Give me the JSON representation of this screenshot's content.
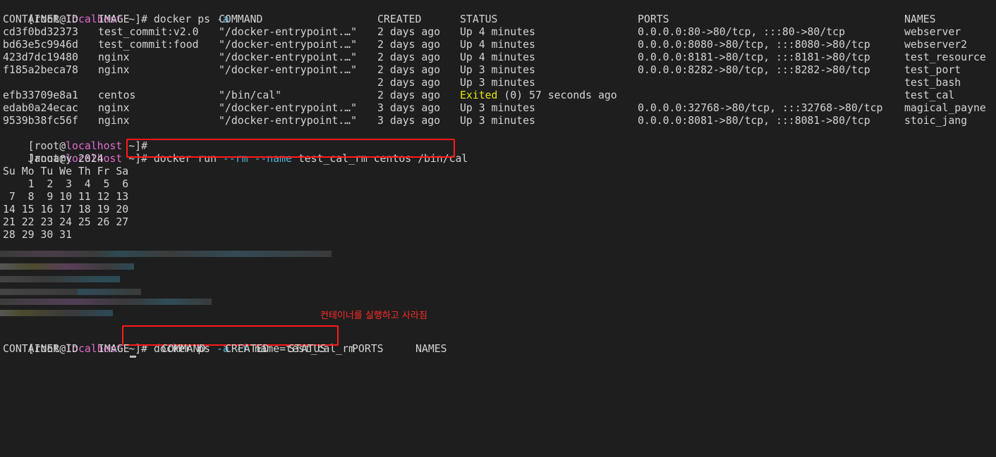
{
  "prompt": {
    "user": "root",
    "host": "localhost",
    "path": "~",
    "open": "[",
    "at": "@",
    "close_symbol": "]# "
  },
  "cmd1": {
    "text": "docker ps ",
    "flag": "-a"
  },
  "ps_table": {
    "headers": [
      "CONTAINER ID",
      "IMAGE",
      "COMMAND",
      "CREATED",
      "STATUS",
      "PORTS",
      "NAMES"
    ],
    "rows": [
      [
        "cd3f0bd32373",
        "test_commit:v2.0",
        "\"/docker-entrypoint.…\"",
        "2 days ago",
        "Up 4 minutes",
        "0.0.0.0:80->80/tcp, :::80->80/tcp",
        "webserver"
      ],
      [
        "bd63e5c9946d",
        "test_commit:food",
        "\"/docker-entrypoint.…\"",
        "2 days ago",
        "Up 4 minutes",
        "0.0.0.0:8080->80/tcp, :::8080->80/tcp",
        "webserver2"
      ],
      [
        "423d7dc19480",
        "nginx",
        "\"/docker-entrypoint.…\"",
        "2 days ago",
        "Up 4 minutes",
        "0.0.0.0:8181->80/tcp, :::8181->80/tcp",
        "test_resource"
      ],
      [
        "f185a2beca78",
        "nginx",
        "\"/docker-entrypoint.…\"",
        "2 days ago",
        "Up 3 minutes",
        "0.0.0.0:8282->80/tcp, :::8282->80/tcp",
        "test_port"
      ],
      [
        "",
        "",
        "",
        "2 days ago",
        "Up 3 minutes",
        "",
        "test_bash"
      ],
      [
        "efb33709e8a1",
        "centos",
        "\"/bin/cal\"",
        "2 days ago",
        "",
        "",
        "test_cal"
      ],
      [
        "edab0a24ecac",
        "nginx",
        "\"/docker-entrypoint.…\"",
        "3 days ago",
        "Up 3 minutes",
        "0.0.0.0:32768->80/tcp, :::32768->80/tcp",
        "magical_payne"
      ],
      [
        "9539b38fc56f",
        "nginx",
        "\"/docker-entrypoint.…\"",
        "3 days ago",
        "Up 3 minutes",
        "0.0.0.0:8081->80/tcp, :::8081->80/tcp",
        "stoic_jang"
      ]
    ],
    "exited_status": {
      "word": "Exited",
      "rest": " (0) 57 seconds ago"
    }
  },
  "cmd2": {
    "p1": "docker run ",
    "flag1": "--rm",
    "p2": " ",
    "flag2": "--name",
    "p3": " test_cal_rm centos /bin/cal"
  },
  "calendar": {
    "title": "    January 2024",
    "weekdays": "Su Mo Tu We Th Fr Sa",
    "weeks": [
      "    1  2  3  4  5  6",
      " 7  8  9 10 11 12 13",
      "14 15 16 17 18 19 20",
      "21 22 23 24 25 26 27",
      "28 29 30 31"
    ]
  },
  "annotation": "컨테이너를 실행하고 사라짐",
  "cmd3": {
    "p1": "docker ps ",
    "flag1": "-a",
    "p2": " ",
    "flag2": "-f",
    "p3": " name=test_cal_rm"
  },
  "ps_table2": {
    "headers": [
      "CONTAINER ID",
      "IMAGE",
      "COMMAND",
      "CREATED",
      "STATUS",
      "PORTS",
      "NAMES"
    ]
  },
  "colors": {
    "background": "#1e1e1e",
    "text": "#d4d4d4",
    "host": "#e06cd0",
    "flag": "#4fb3d9",
    "exited": "#e5e510",
    "highlight_box": "#ff1a1a"
  }
}
